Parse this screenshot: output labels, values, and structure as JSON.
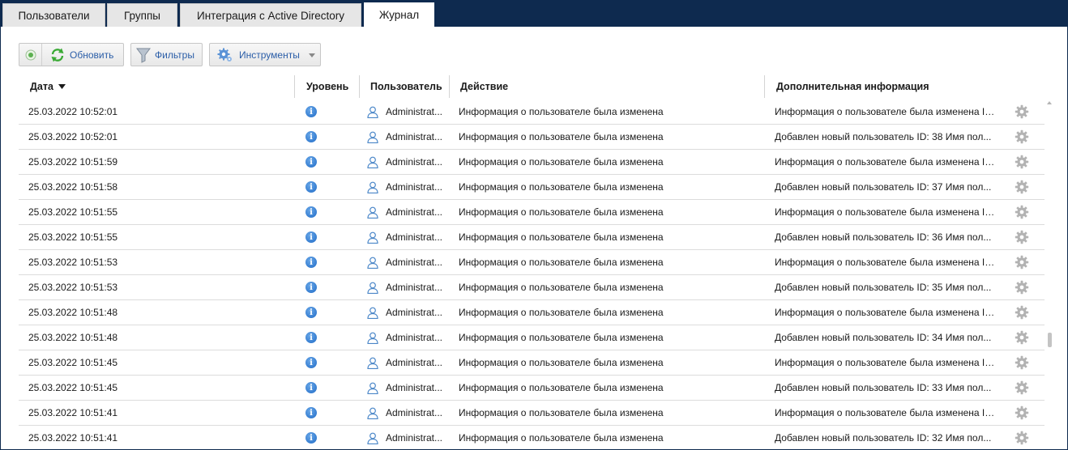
{
  "tabs": [
    {
      "label": "Пользователи",
      "active": false
    },
    {
      "label": "Группы",
      "active": false
    },
    {
      "label": "Интеграция с Active Directory",
      "active": false
    },
    {
      "label": "Журнал",
      "active": true
    }
  ],
  "toolbar": {
    "refresh_label": "Обновить",
    "filters_label": "Фильтры",
    "tools_label": "Инструменты"
  },
  "columns": {
    "date": "Дата",
    "level": "Уровень",
    "user": "Пользователь",
    "action": "Действие",
    "info": "Дополнительная информация"
  },
  "sort": {
    "column": "date",
    "direction": "descending"
  },
  "rows": [
    {
      "date": "25.03.2022 10:52:01",
      "level": "info",
      "user": "Administrat...",
      "action": "Информация о пользователе была изменена",
      "info": "Информация о пользователе была изменена ID..."
    },
    {
      "date": "25.03.2022 10:52:01",
      "level": "info",
      "user": "Administrat...",
      "action": "Информация о пользователе была изменена",
      "info": "Добавлен новый пользователь  ID:   38 Имя пол..."
    },
    {
      "date": "25.03.2022 10:51:59",
      "level": "info",
      "user": "Administrat...",
      "action": "Информация о пользователе была изменена",
      "info": "Информация о пользователе была изменена ID..."
    },
    {
      "date": "25.03.2022 10:51:58",
      "level": "info",
      "user": "Administrat...",
      "action": "Информация о пользователе была изменена",
      "info": "Добавлен новый пользователь  ID:   37 Имя пол..."
    },
    {
      "date": "25.03.2022 10:51:55",
      "level": "info",
      "user": "Administrat...",
      "action": "Информация о пользователе была изменена",
      "info": "Информация о пользователе была изменена ID..."
    },
    {
      "date": "25.03.2022 10:51:55",
      "level": "info",
      "user": "Administrat...",
      "action": "Информация о пользователе была изменена",
      "info": "Добавлен новый пользователь  ID:   36 Имя пол..."
    },
    {
      "date": "25.03.2022 10:51:53",
      "level": "info",
      "user": "Administrat...",
      "action": "Информация о пользователе была изменена",
      "info": "Информация о пользователе была изменена ID..."
    },
    {
      "date": "25.03.2022 10:51:53",
      "level": "info",
      "user": "Administrat...",
      "action": "Информация о пользователе была изменена",
      "info": "Добавлен новый пользователь  ID:   35 Имя пол..."
    },
    {
      "date": "25.03.2022 10:51:48",
      "level": "info",
      "user": "Administrat...",
      "action": "Информация о пользователе была изменена",
      "info": "Информация о пользователе была изменена ID..."
    },
    {
      "date": "25.03.2022 10:51:48",
      "level": "info",
      "user": "Administrat...",
      "action": "Информация о пользователе была изменена",
      "info": "Добавлен новый пользователь  ID:   34 Имя пол..."
    },
    {
      "date": "25.03.2022 10:51:45",
      "level": "info",
      "user": "Administrat...",
      "action": "Информация о пользователе была изменена",
      "info": "Информация о пользователе была изменена ID..."
    },
    {
      "date": "25.03.2022 10:51:45",
      "level": "info",
      "user": "Administrat...",
      "action": "Информация о пользователе была изменена",
      "info": "Добавлен новый пользователь  ID:   33 Имя пол..."
    },
    {
      "date": "25.03.2022 10:51:41",
      "level": "info",
      "user": "Administrat...",
      "action": "Информация о пользователе была изменена",
      "info": "Информация о пользователе была изменена ID..."
    },
    {
      "date": "25.03.2022 10:51:41",
      "level": "info",
      "user": "Administrat...",
      "action": "Информация о пользователе была изменена",
      "info": "Добавлен новый пользователь  ID:   32 Имя пол..."
    }
  ],
  "colors": {
    "tabbar_bg": "#0e2a4f",
    "link_blue": "#2b5ea8",
    "info_blue": "#1f6bc7",
    "refresh_green": "#3aaa35"
  }
}
